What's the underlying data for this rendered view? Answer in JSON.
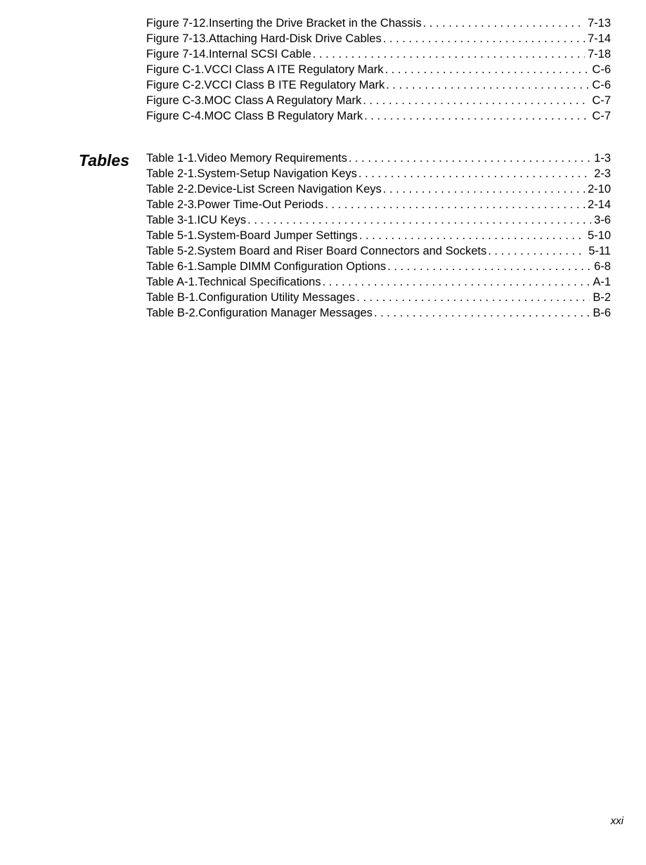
{
  "figures": [
    {
      "label": "Figure 7-12.",
      "title": "Inserting the Drive Bracket in the Chassis",
      "page": "7-13"
    },
    {
      "label": "Figure 7-13.",
      "title": "Attaching Hard-Disk Drive Cables",
      "page": "7-14"
    },
    {
      "label": "Figure 7-14.",
      "title": "Internal SCSI Cable",
      "page": "7-18"
    },
    {
      "label": "Figure C-1.",
      "title": "VCCI Class A ITE Regulatory Mark",
      "page": "C-6"
    },
    {
      "label": "Figure C-2.",
      "title": "VCCI Class B ITE Regulatory Mark",
      "page": "C-6"
    },
    {
      "label": "Figure C-3.",
      "title": "MOC Class A Regulatory Mark",
      "page": "C-7"
    },
    {
      "label": "Figure C-4.",
      "title": "MOC Class B Regulatory Mark",
      "page": "C-7"
    }
  ],
  "tables_heading": "Tables",
  "tables": [
    {
      "label": "Table 1-1.",
      "title": "Video Memory Requirements",
      "page": "1-3"
    },
    {
      "label": "Table 2-1.",
      "title": "System-Setup Navigation Keys ",
      "page": "2-3"
    },
    {
      "label": "Table 2-2.",
      "title": "Device-List Screen Navigation Keys",
      "page": "2-10"
    },
    {
      "label": "Table 2-3.",
      "title": "Power Time-Out Periods",
      "page": "2-14"
    },
    {
      "label": "Table 3-1.",
      "title": "ICU Keys",
      "page": "3-6"
    },
    {
      "label": "Table 5-1.",
      "title": "System-Board Jumper Settings",
      "page": "5-10"
    },
    {
      "label": "Table 5-2.",
      "title": "System Board and Riser Board Connectors and Sockets",
      "page": "5-11"
    },
    {
      "label": "Table 6-1.",
      "title": "Sample DIMM Configuration Options",
      "page": "6-8"
    },
    {
      "label": "Table A-1.",
      "title": "Technical Specifications",
      "page": "A-1"
    },
    {
      "label": "Table B-1.",
      "title": "Configuration Utility Messages",
      "page": "B-2"
    },
    {
      "label": "Table B-2.",
      "title": "Configuration Manager Messages",
      "page": "B-6"
    }
  ],
  "page_number": "xxi"
}
